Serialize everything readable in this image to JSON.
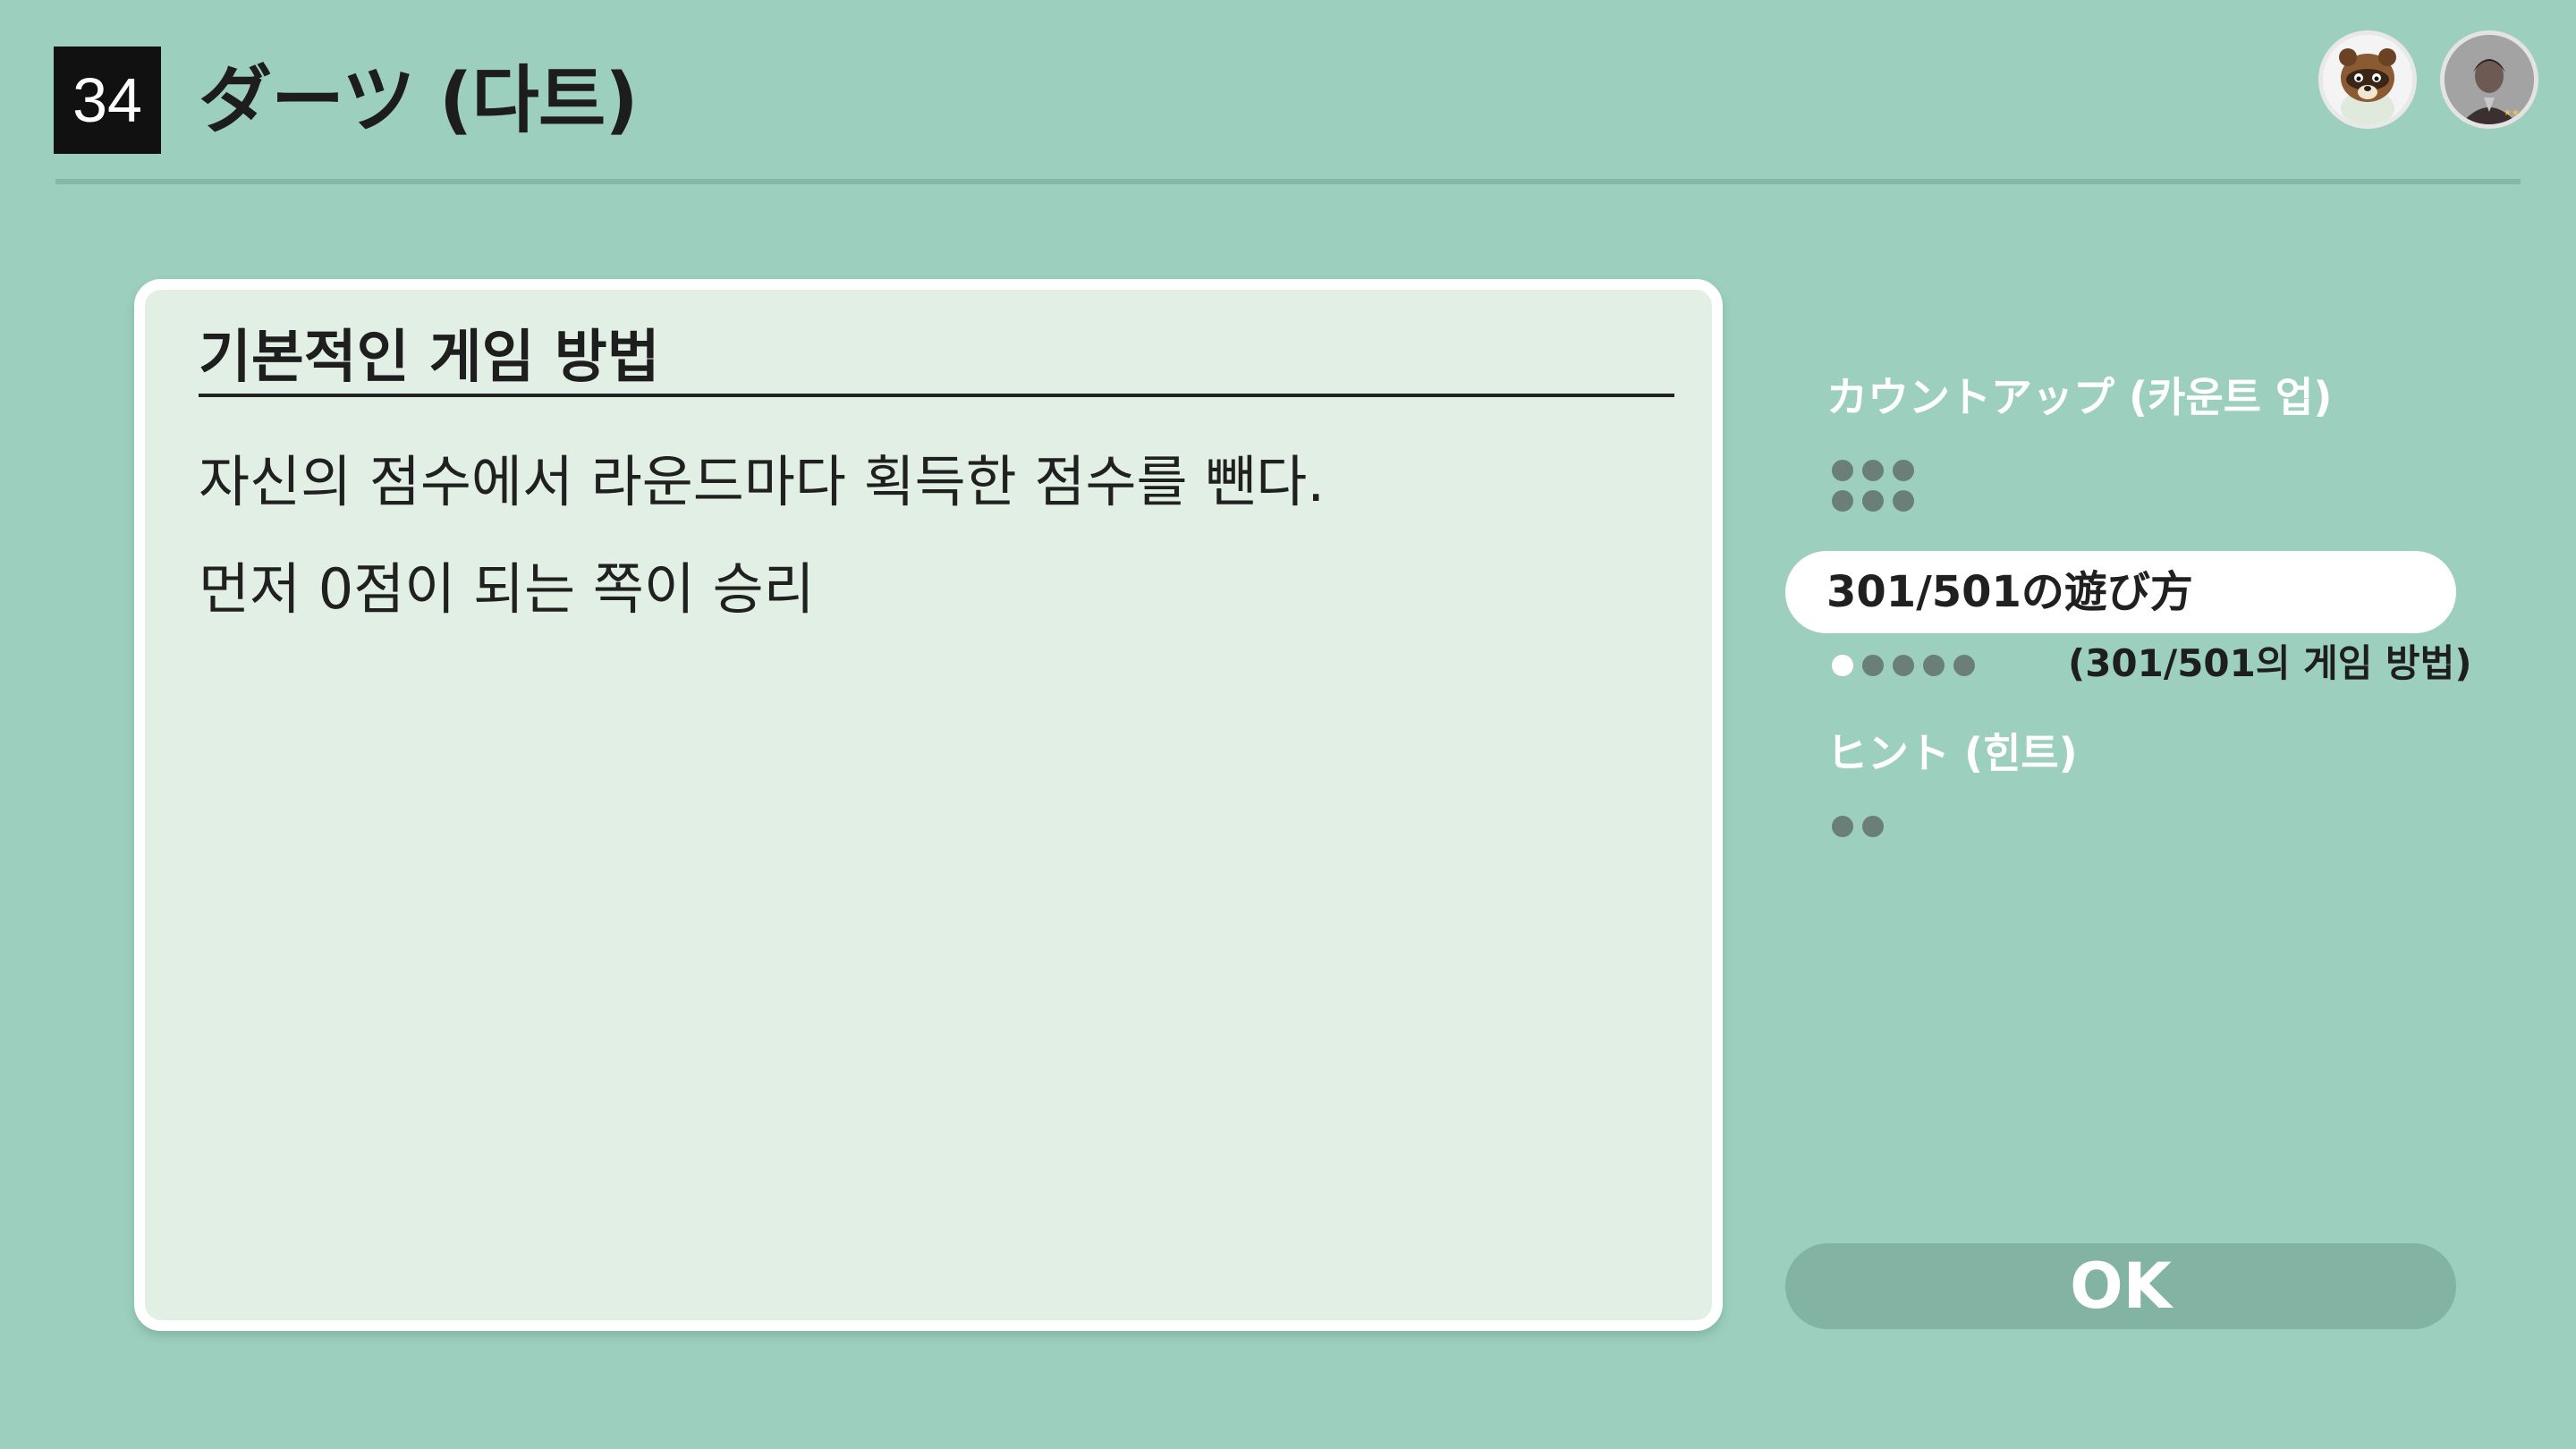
{
  "header": {
    "number": "34",
    "title": "ダーツ (다트)"
  },
  "panel": {
    "heading": "기본적인 게임 방법",
    "lines": [
      "자신의 점수에서 라운드마다 획득한 점수를 뺀다.",
      "먼저 0점이 되는 쪽이 승리"
    ]
  },
  "menu": {
    "items": [
      {
        "label": "カウントアップ (카운트 업)",
        "dots_total": 6,
        "dots_active": 0,
        "selected": false
      },
      {
        "label": "301/501の遊び方",
        "subtitle": "(301/501의 게임 방법)",
        "dots_total": 5,
        "dots_active": 1,
        "selected": true
      },
      {
        "label": "ヒント (힌트)",
        "dots_total": 2,
        "dots_active": 0,
        "selected": false
      }
    ]
  },
  "ok_label": "OK",
  "icons": {
    "avatar_1": "raccoon-avatar-icon",
    "avatar_2": "player-avatar-icon"
  },
  "colors": {
    "background": "#9dcfbf",
    "panel": "#e2efe5",
    "selected_pill": "#ffffff",
    "ok_button": "#82b3a3"
  }
}
